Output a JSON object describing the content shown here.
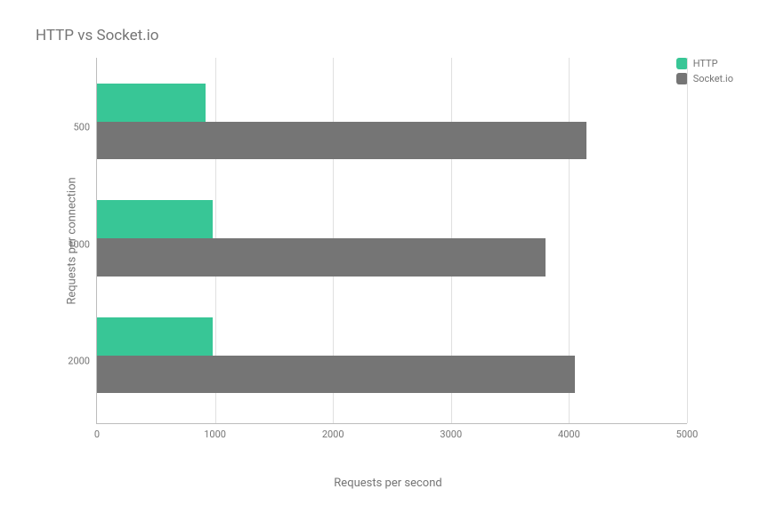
{
  "chart_data": {
    "type": "bar",
    "orientation": "horizontal",
    "title": "HTTP vs Socket.io",
    "xlabel": "Requests per second",
    "ylabel": "Requests per connection",
    "xlim": [
      0,
      5000
    ],
    "categories": [
      "500",
      "1000",
      "2000"
    ],
    "series": [
      {
        "name": "HTTP",
        "values": [
          920,
          980,
          980
        ],
        "color": "#38c696"
      },
      {
        "name": "Socket.io",
        "values": [
          4150,
          3800,
          4050
        ],
        "color": "#757575"
      }
    ],
    "x_ticks": [
      0,
      1000,
      2000,
      3000,
      4000,
      5000
    ]
  }
}
